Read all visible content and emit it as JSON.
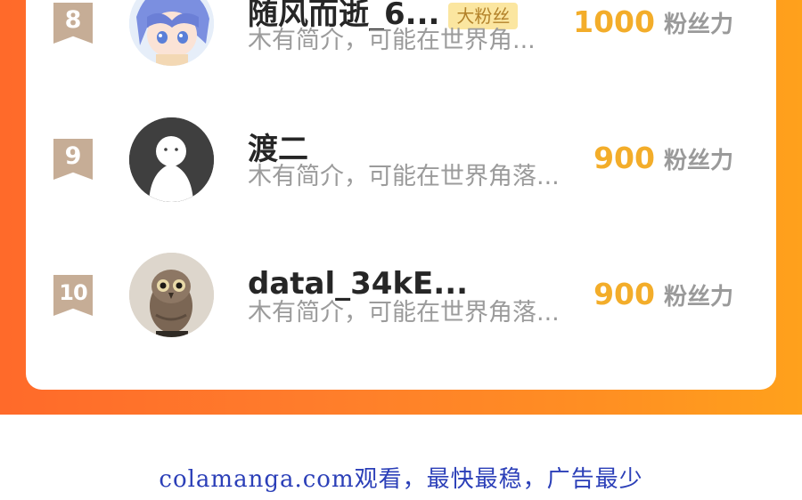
{
  "rows": [
    {
      "rank": "8",
      "name": "随风而逝_6...",
      "badge": "大粉丝",
      "desc": "木有简介，可能在世界角...",
      "score": "1000",
      "unit": "粉丝力"
    },
    {
      "rank": "9",
      "name": "渡二",
      "badge": "",
      "desc": "木有简介，可能在世界角落...",
      "score": "900",
      "unit": "粉丝力"
    },
    {
      "rank": "10",
      "name": "datal_34kE...",
      "badge": "",
      "desc": "木有简介，可能在世界角落...",
      "score": "900",
      "unit": "粉丝力"
    }
  ],
  "footer": "colamanga.com观看，最快最稳，广告最少",
  "colors": {
    "rank_badge": "#c6ad96",
    "score": "#f3ad2a",
    "band": "#ff7d2b",
    "footer_text": "#2b3fb8"
  },
  "avatars": [
    "anime-girl-avatar",
    "default-ghost-avatar",
    "owl-photo-avatar"
  ]
}
